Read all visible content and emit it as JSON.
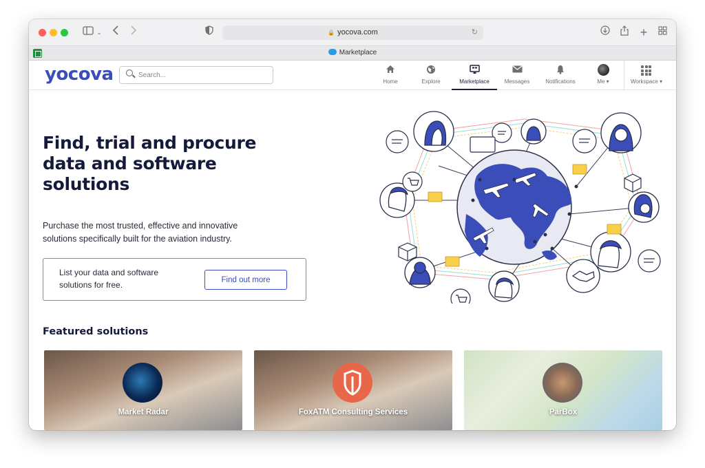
{
  "browser": {
    "url": "yocova.com",
    "tab_title": "Marketplace"
  },
  "header": {
    "logo": "yocova",
    "search_placeholder": "Search...",
    "nav": [
      {
        "label": "Home",
        "icon": "home-icon"
      },
      {
        "label": "Explore",
        "icon": "globe-icon"
      },
      {
        "label": "Marketplace",
        "icon": "marketplace-icon",
        "active": true
      },
      {
        "label": "Messages",
        "icon": "envelope-icon"
      },
      {
        "label": "Notifications",
        "icon": "bell-icon"
      },
      {
        "label": "Me ▾",
        "icon": "avatar"
      },
      {
        "label": "Workspace ▾",
        "icon": "grid-icon"
      }
    ]
  },
  "hero": {
    "title": "Find, trial and procure data and software solutions",
    "subtitle": "Purchase the most trusted, effective and innovative solutions specifically built for the aviation industry.",
    "list_text": "List your data and software solutions for free.",
    "cta_label": "Find out more"
  },
  "featured": {
    "heading": "Featured solutions",
    "cards": [
      {
        "name": "Market Radar"
      },
      {
        "name": "FoxATM Consulting Services"
      },
      {
        "name": "ParBox"
      }
    ]
  },
  "colors": {
    "brand": "#3b4db8",
    "heading": "#151a3b",
    "accent_orange": "#e8664a"
  }
}
